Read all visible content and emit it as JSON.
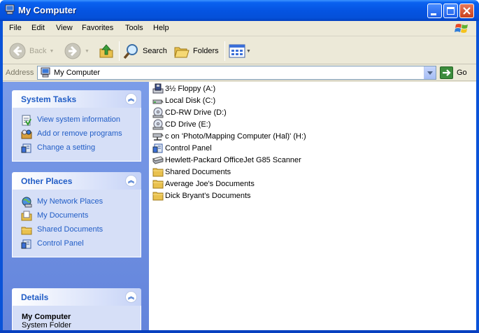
{
  "window": {
    "title": "My Computer"
  },
  "menu": {
    "items": [
      "File",
      "Edit",
      "View",
      "Favorites",
      "Tools",
      "Help"
    ]
  },
  "toolbar": {
    "back_label": "Back",
    "search_label": "Search",
    "folders_label": "Folders"
  },
  "address": {
    "label": "Address",
    "value": "My Computer",
    "go_label": "Go"
  },
  "task_pane": {
    "system_tasks": {
      "title": "System Tasks",
      "items": [
        "View system information",
        "Add or remove programs",
        "Change a setting"
      ]
    },
    "other_places": {
      "title": "Other Places",
      "items": [
        "My Network Places",
        "My Documents",
        "Shared Documents",
        "Control Panel"
      ]
    },
    "details": {
      "title": "Details",
      "name": "My Computer",
      "type": "System Folder"
    }
  },
  "files": [
    {
      "label": "3½ Floppy (A:)",
      "icon": "floppy-drive-icon"
    },
    {
      "label": "Local Disk (C:)",
      "icon": "hard-disk-icon"
    },
    {
      "label": "CD-RW Drive (D:)",
      "icon": "cd-drive-icon"
    },
    {
      "label": "CD Drive (E:)",
      "icon": "cd-drive-icon"
    },
    {
      "label": "c on 'Photo/Mapping Computer (Hal)' (H:)",
      "icon": "network-drive-icon"
    },
    {
      "label": "Control Panel",
      "icon": "control-panel-icon"
    },
    {
      "label": "Hewlett-Packard OfficeJet G85 Scanner",
      "icon": "scanner-icon"
    },
    {
      "label": "Shared Documents",
      "icon": "folder-icon"
    },
    {
      "label": "Average Joe's Documents",
      "icon": "folder-icon"
    },
    {
      "label": "Dick Bryant's Documents",
      "icon": "folder-icon"
    }
  ],
  "colors": {
    "title_bar": "#0554e2",
    "task_link": "#215dc6",
    "task_pane": "#7b9ce8"
  }
}
